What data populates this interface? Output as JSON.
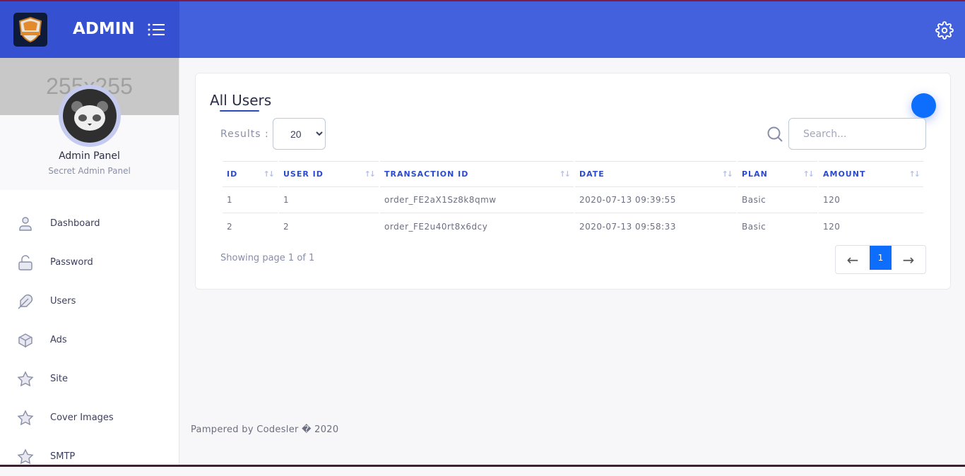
{
  "header": {
    "title": "ADMIN"
  },
  "profile": {
    "cover_text": "255x255",
    "name": "Admin Panel",
    "subtitle": "Secret Admin Panel"
  },
  "sidebar": {
    "items": [
      {
        "label": "Dashboard",
        "icon": "user-icon"
      },
      {
        "label": "Password",
        "icon": "unlock-icon"
      },
      {
        "label": "Users",
        "icon": "feather-icon"
      },
      {
        "label": "Ads",
        "icon": "box-icon"
      },
      {
        "label": "Site",
        "icon": "star-icon"
      },
      {
        "label": "Cover Images",
        "icon": "star-icon"
      },
      {
        "label": "SMTP",
        "icon": "star-icon"
      }
    ]
  },
  "main": {
    "title": "All Users",
    "results_label": "Results :",
    "results_value": "20",
    "search_placeholder": "Search...",
    "columns": [
      "ID",
      "USER ID",
      "TRANSACTION ID",
      "DATE",
      "PLAN",
      "AMOUNT"
    ],
    "rows": [
      [
        "1",
        "1",
        "order_FE2aX1Sz8k8qmw",
        "2020-07-13 09:39:55",
        "Basic",
        "120"
      ],
      [
        "2",
        "2",
        "order_FE2u40rt8x6dcy",
        "2020-07-13 09:58:33",
        "Basic",
        "120"
      ]
    ],
    "showing": "Showing page 1 of 1",
    "current_page": "1",
    "prev": "←",
    "next": "→",
    "sort_glyph": "↑↓"
  },
  "footer": "Pampered by Codesler � 2020",
  "colors": {
    "header": "#4361dd",
    "brand": "#3550d0",
    "accent": "#0d6efd"
  }
}
